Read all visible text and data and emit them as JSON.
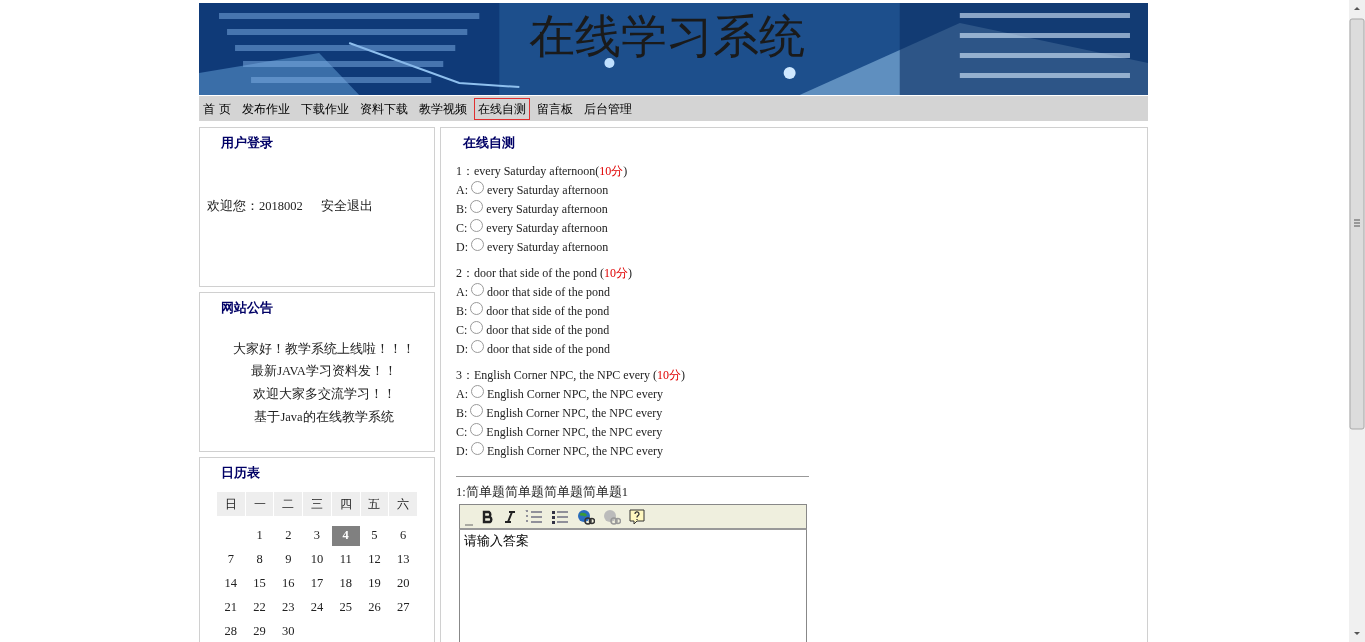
{
  "header": {
    "title": "在线学习系统"
  },
  "nav": [
    {
      "label": "首 页",
      "selected": false
    },
    {
      "label": "发布作业",
      "selected": false
    },
    {
      "label": "下载作业",
      "selected": false
    },
    {
      "label": "资料下载",
      "selected": false
    },
    {
      "label": "教学视频",
      "selected": false
    },
    {
      "label": "在线自测",
      "selected": true
    },
    {
      "label": "留言板",
      "selected": false
    },
    {
      "label": "后台管理",
      "selected": false
    }
  ],
  "login": {
    "title": "用户登录",
    "welcome": "欢迎您：2018002",
    "logout": "安全退出"
  },
  "notice": {
    "title": "网站公告",
    "items": [
      "大家好！教学系统上线啦！！！",
      "最新JAVA学习资料发！！",
      "欢迎大家多交流学习！！",
      "基于Java的在线教学系统"
    ]
  },
  "calendar": {
    "title": "日历表",
    "weekdays": [
      "日",
      "一",
      "二",
      "三",
      "四",
      "五",
      "六"
    ],
    "days": [
      {
        "label": "1",
        "selected": false
      },
      {
        "label": "2",
        "selected": false
      },
      {
        "label": "3",
        "selected": false
      },
      {
        "label": "4",
        "selected": true
      },
      {
        "label": "5",
        "selected": false
      },
      {
        "label": "6",
        "selected": false
      },
      {
        "label": "7",
        "selected": false
      },
      {
        "label": "8",
        "selected": false
      },
      {
        "label": "9",
        "selected": false
      },
      {
        "label": "10",
        "selected": false
      },
      {
        "label": "11",
        "selected": false
      },
      {
        "label": "12",
        "selected": false
      },
      {
        "label": "13",
        "selected": false
      },
      {
        "label": "14",
        "selected": false
      },
      {
        "label": "15",
        "selected": false
      },
      {
        "label": "16",
        "selected": false
      },
      {
        "label": "17",
        "selected": false
      },
      {
        "label": "18",
        "selected": false
      },
      {
        "label": "19",
        "selected": false
      },
      {
        "label": "20",
        "selected": false
      },
      {
        "label": "21",
        "selected": false
      },
      {
        "label": "22",
        "selected": false
      },
      {
        "label": "23",
        "selected": false
      },
      {
        "label": "24",
        "selected": false
      },
      {
        "label": "25",
        "selected": false
      },
      {
        "label": "26",
        "selected": false
      },
      {
        "label": "27",
        "selected": false
      },
      {
        "label": "28",
        "selected": false
      },
      {
        "label": "29",
        "selected": false
      },
      {
        "label": "30",
        "selected": false
      }
    ]
  },
  "quiz": {
    "title": "在线自测",
    "questions": [
      {
        "number": "1：",
        "text": "every Saturday afternoon(",
        "score": "10分",
        "close": ")",
        "options": [
          {
            "letter": "A:",
            "text": "every Saturday afternoon",
            "checked": false
          },
          {
            "letter": "B:",
            "text": "every Saturday afternoon",
            "checked": false
          },
          {
            "letter": "C:",
            "text": "every Saturday afternoon",
            "checked": false
          },
          {
            "letter": "D:",
            "text": "every Saturday afternoon",
            "checked": false
          }
        ]
      },
      {
        "number": "2：",
        "text": "door that side of the pond (",
        "score": "10分",
        "close": ")",
        "options": [
          {
            "letter": "A:",
            "text": "door that side of the pond",
            "checked": false
          },
          {
            "letter": "B:",
            "text": "door that side of the pond",
            "checked": false
          },
          {
            "letter": "C:",
            "text": "door that side of the pond",
            "checked": false
          },
          {
            "letter": "D:",
            "text": "door that side of the pond",
            "checked": false
          }
        ]
      },
      {
        "number": "3：",
        "text": "English Corner NPC, the NPC every (",
        "score": "10分",
        "close": ")",
        "options": [
          {
            "letter": "A:",
            "text": "English Corner NPC, the NPC every",
            "checked": false
          },
          {
            "letter": "B:",
            "text": "English Corner NPC, the NPC every",
            "checked": false
          },
          {
            "letter": "C:",
            "text": "English Corner NPC, the NPC every",
            "checked": false
          },
          {
            "letter": "D:",
            "text": "English Corner NPC, the NPC every",
            "checked": false
          }
        ]
      }
    ],
    "short_answer": {
      "question": "1:简单题简单题简单题简单题1",
      "value": "请输入答案"
    }
  }
}
